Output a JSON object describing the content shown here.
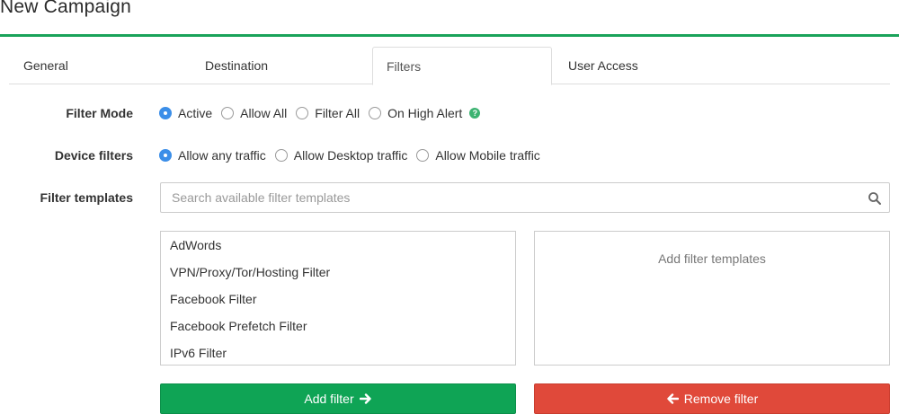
{
  "page": {
    "title": "New Campaign"
  },
  "tabs": [
    {
      "label": "General",
      "active": false
    },
    {
      "label": "Destination",
      "active": false
    },
    {
      "label": "Filters",
      "active": true
    },
    {
      "label": "User Access",
      "active": false
    }
  ],
  "filter_mode": {
    "label": "Filter Mode",
    "options": [
      "Active",
      "Allow All",
      "Filter All",
      "On High Alert"
    ],
    "selected": "Active",
    "help_icon": "question-circle-icon"
  },
  "device_filters": {
    "label": "Device filters",
    "options": [
      "Allow any traffic",
      "Allow Desktop traffic",
      "Allow Mobile traffic"
    ],
    "selected": "Allow any traffic"
  },
  "filter_templates": {
    "label": "Filter templates",
    "search": {
      "placeholder": "Search available filter templates",
      "value": "",
      "icon": "search-icon"
    },
    "available": [
      "AdWords",
      "VPN/Proxy/Tor/Hosting Filter",
      "Facebook Filter",
      "Facebook Prefetch Filter",
      "IPv6 Filter"
    ],
    "selected_placeholder": "Add filter templates"
  },
  "buttons": {
    "add_label": "Add filter",
    "add_icon": "arrow-right-icon",
    "remove_label": "Remove filter",
    "remove_icon": "arrow-left-icon"
  },
  "colors": {
    "accent": "#1aa35a",
    "radio_checked": "#3b8ee8",
    "add_button": "#0fa455",
    "remove_button": "#e0493a",
    "help_icon": "#3cb371"
  }
}
